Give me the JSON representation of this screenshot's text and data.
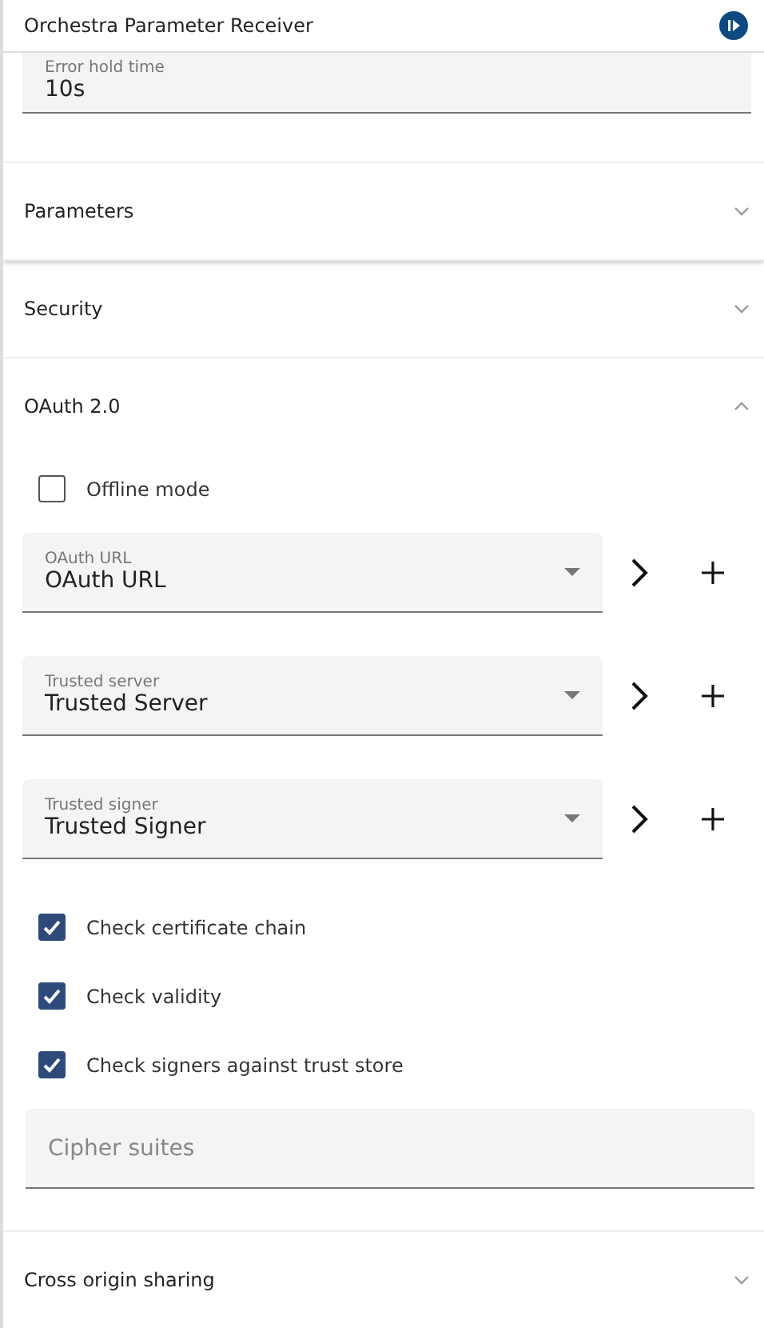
{
  "header": {
    "title": "Orchestra Parameter Receiver"
  },
  "top_field": {
    "label": "Error hold time",
    "value": "10s"
  },
  "sections": [
    {
      "title": "Parameters",
      "expanded": false
    },
    {
      "title": "Security",
      "expanded": false
    },
    {
      "title": "OAuth 2.0",
      "expanded": true,
      "items": [
        {
          "kind": "checkbox",
          "label": "Offline mode",
          "checked": false
        },
        {
          "kind": "select",
          "label": "OAuth URL",
          "value": "OAuth URL"
        },
        {
          "kind": "select",
          "label": "Trusted server",
          "value": "Trusted Server"
        },
        {
          "kind": "select",
          "label": "Trusted signer",
          "value": "Trusted Signer"
        },
        {
          "kind": "checkbox",
          "label": "Check certificate chain",
          "checked": true
        },
        {
          "kind": "checkbox",
          "label": "Check validity",
          "checked": true
        },
        {
          "kind": "checkbox",
          "label": "Check signers against trust store",
          "checked": true
        },
        {
          "kind": "text",
          "placeholder": "Cipher suites"
        }
      ]
    },
    {
      "title": "Cross origin sharing",
      "expanded": false
    }
  ]
}
